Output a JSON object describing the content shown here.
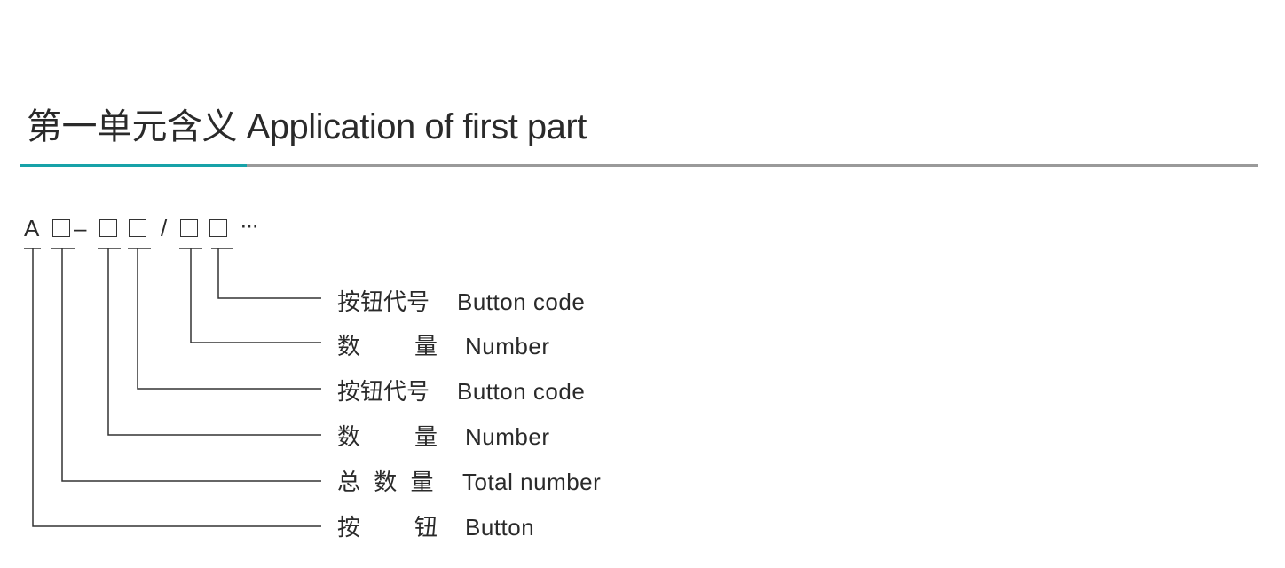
{
  "header": {
    "title": "第一单元含义 Application of first part",
    "accent_color": "#17a2a8",
    "rule_color": "#9a9a9a"
  },
  "code": {
    "prefix": "A",
    "dash": "–",
    "slash": "/",
    "ellipsis": "···",
    "boxes": 5
  },
  "legend": [
    {
      "cn": "按钮代号",
      "en": "Button code",
      "points_to": "box-5"
    },
    {
      "cn": "数　　量",
      "en": "Number",
      "points_to": "box-4"
    },
    {
      "cn": "按钮代号",
      "en": "Button code",
      "points_to": "box-3"
    },
    {
      "cn": "数　　量",
      "en": "Number",
      "points_to": "box-2"
    },
    {
      "cn": "总 数 量",
      "en": "Total number",
      "points_to": "box-1"
    },
    {
      "cn": "按　　钮",
      "en": "Button",
      "points_to": "prefix-A"
    }
  ]
}
